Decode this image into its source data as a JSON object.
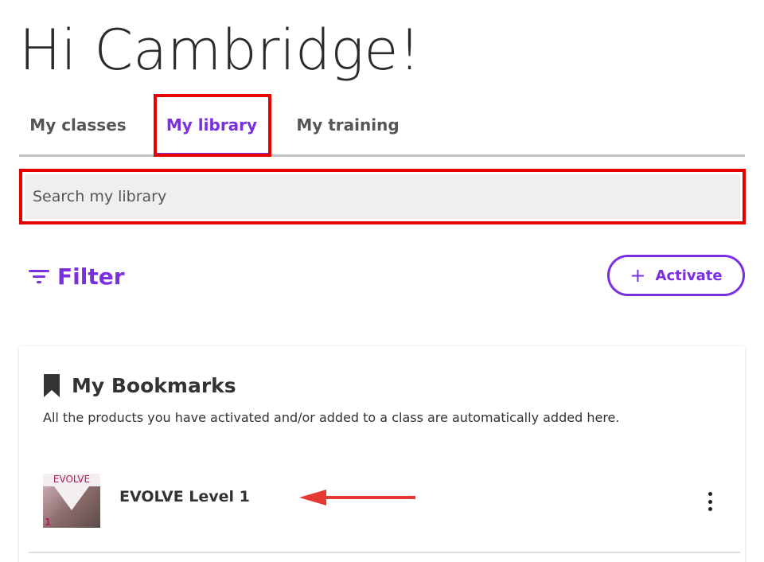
{
  "greeting": "Hi Cambridge!",
  "tabs": [
    {
      "label": "My classes",
      "active": false
    },
    {
      "label": "My library",
      "active": true
    },
    {
      "label": "My training",
      "active": false
    }
  ],
  "search": {
    "placeholder": "Search my library",
    "value": ""
  },
  "filter": {
    "label": "Filter",
    "icon": "filter-icon"
  },
  "activate": {
    "label": "Activate",
    "icon": "plus-icon"
  },
  "bookmarks": {
    "icon": "bookmark-icon",
    "title": "My Bookmarks",
    "description": "All the products you have activated and/or added to a class are automatically added here.",
    "items": [
      {
        "name": "EVOLVE Level 1",
        "thumb_brand": "EVOLVE",
        "thumb_level": "1",
        "menu_icon": "more-vertical-icon"
      }
    ]
  },
  "colors": {
    "accent": "#7a2fe0",
    "highlight": "#e60000",
    "annotation_arrow": "#e53935",
    "text": "#333333",
    "search_bg": "#efefef"
  }
}
